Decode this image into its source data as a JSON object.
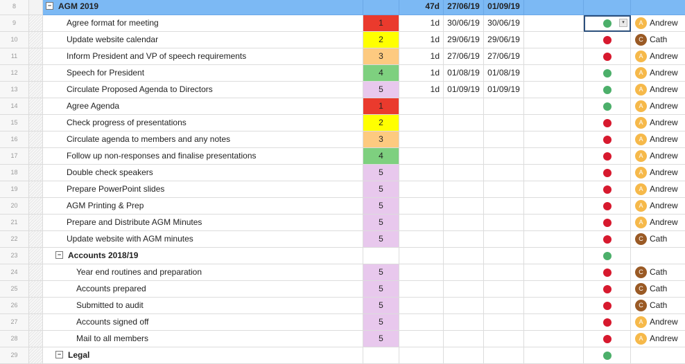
{
  "colors": {
    "header_bg": "#7cb9f4",
    "prio_1": "#ea3a2d",
    "prio_2": "#ffff00",
    "prio_3": "#fdca80",
    "prio_4": "#7ed07f",
    "prio_5": "#e8c8ed",
    "status_green": "#4caf6a",
    "status_red": "#d7192e",
    "avatar_andrew": "#f6b94a",
    "avatar_cath": "#9a5a25"
  },
  "rows": [
    {
      "num": "8",
      "kind": "parent",
      "name": "AGM 2019",
      "duration": "47d",
      "start": "27/06/19",
      "end": "01/09/19"
    },
    {
      "num": "9",
      "kind": "task",
      "name": "Agree format for meeting",
      "priority": "1",
      "duration": "1d",
      "start": "30/06/19",
      "end": "30/06/19",
      "status": "green",
      "initial": "A",
      "assignee": "Andrew",
      "selected": true
    },
    {
      "num": "10",
      "kind": "task",
      "name": "Update website calendar",
      "priority": "2",
      "duration": "1d",
      "start": "29/06/19",
      "end": "29/06/19",
      "status": "red",
      "initial": "C",
      "assignee": "Cath"
    },
    {
      "num": "11",
      "kind": "task",
      "name": "Inform President and VP of speech requirements",
      "priority": "3",
      "duration": "1d",
      "start": "27/06/19",
      "end": "27/06/19",
      "status": "red",
      "initial": "A",
      "assignee": "Andrew"
    },
    {
      "num": "12",
      "kind": "task",
      "name": "Speech for President",
      "priority": "4",
      "duration": "1d",
      "start": "01/08/19",
      "end": "01/08/19",
      "status": "green",
      "initial": "A",
      "assignee": "Andrew"
    },
    {
      "num": "13",
      "kind": "task",
      "name": "Circulate Proposed Agenda to Directors",
      "priority": "5",
      "duration": "1d",
      "start": "01/09/19",
      "end": "01/09/19",
      "status": "green",
      "initial": "A",
      "assignee": "Andrew"
    },
    {
      "num": "14",
      "kind": "task",
      "name": "Agree Agenda",
      "priority": "1",
      "status": "green",
      "initial": "A",
      "assignee": "Andrew"
    },
    {
      "num": "15",
      "kind": "task",
      "name": "Check progress of presentations",
      "priority": "2",
      "status": "red",
      "initial": "A",
      "assignee": "Andrew"
    },
    {
      "num": "16",
      "kind": "task",
      "name": "Circulate agenda to members and any notes",
      "priority": "3",
      "status": "red",
      "initial": "A",
      "assignee": "Andrew"
    },
    {
      "num": "17",
      "kind": "task",
      "name": "Follow up non-responses and finalise presentations",
      "priority": "4",
      "status": "red",
      "initial": "A",
      "assignee": "Andrew"
    },
    {
      "num": "18",
      "kind": "task",
      "name": "Double check speakers",
      "priority": "5",
      "status": "red",
      "initial": "A",
      "assignee": "Andrew"
    },
    {
      "num": "19",
      "kind": "task",
      "name": "Prepare PowerPoint slides",
      "priority": "5",
      "status": "red",
      "initial": "A",
      "assignee": "Andrew"
    },
    {
      "num": "20",
      "kind": "task",
      "name": "AGM Printing & Prep",
      "priority": "5",
      "status": "red",
      "initial": "A",
      "assignee": "Andrew"
    },
    {
      "num": "21",
      "kind": "task",
      "name": "Prepare and Distribute AGM Minutes",
      "priority": "5",
      "status": "red",
      "initial": "A",
      "assignee": "Andrew"
    },
    {
      "num": "22",
      "kind": "task",
      "name": "Update website with AGM minutes",
      "priority": "5",
      "status": "red",
      "initial": "C",
      "assignee": "Cath"
    },
    {
      "num": "23",
      "kind": "parent2",
      "name": "Accounts 2018/19",
      "status": "green"
    },
    {
      "num": "24",
      "kind": "sub",
      "name": "Year end routines and preparation",
      "priority": "5",
      "status": "red",
      "initial": "C",
      "assignee": "Cath"
    },
    {
      "num": "25",
      "kind": "sub",
      "name": "Accounts prepared",
      "priority": "5",
      "status": "red",
      "initial": "C",
      "assignee": "Cath"
    },
    {
      "num": "26",
      "kind": "sub",
      "name": "Submitted to audit",
      "priority": "5",
      "status": "red",
      "initial": "C",
      "assignee": "Cath"
    },
    {
      "num": "27",
      "kind": "sub",
      "name": "Accounts signed off",
      "priority": "5",
      "status": "red",
      "initial": "A",
      "assignee": "Andrew"
    },
    {
      "num": "28",
      "kind": "sub",
      "name": "Mail to all members",
      "priority": "5",
      "status": "red",
      "initial": "A",
      "assignee": "Andrew"
    },
    {
      "num": "29",
      "kind": "parent2",
      "name": "Legal",
      "status": "green"
    }
  ]
}
